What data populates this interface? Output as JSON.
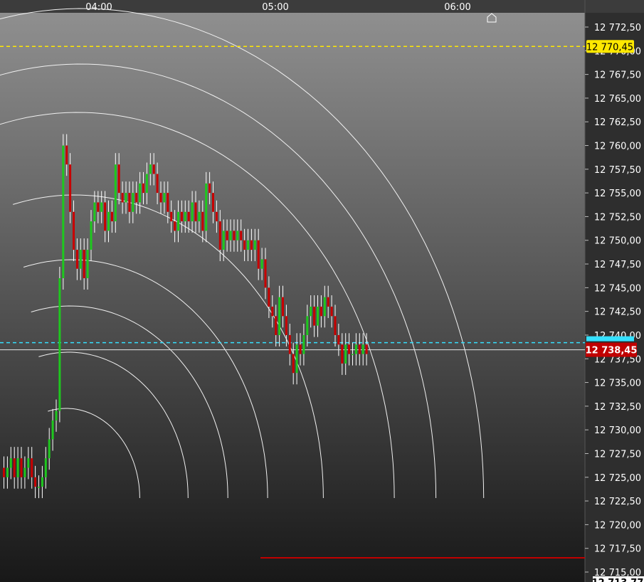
{
  "chart_data": {
    "type": "candlestick",
    "time_labels": [
      "04:00",
      "05:00",
      "06:00"
    ],
    "y_ticks": [
      "12 772,50",
      "12 770,00",
      "12 767,50",
      "12 765,00",
      "12 762,50",
      "12 760,00",
      "12 757,50",
      "12 755,00",
      "12 752,50",
      "12 750,00",
      "12 747,50",
      "12 745,00",
      "12 742,50",
      "12 740,00",
      "12 737,50",
      "12 735,00",
      "12 732,50",
      "12 730,00",
      "12 727,50",
      "12 725,00",
      "12 722,50",
      "12 720,00",
      "12 717,50",
      "12 715,00"
    ],
    "ylim": [
      12715.0,
      12772.5
    ],
    "current_price": {
      "label": "12 738,45",
      "value": 12738.45
    },
    "yellow_level": {
      "label": "12 770,45",
      "value": 12770.45
    },
    "cyan_level": {
      "value": 12739.2
    },
    "red_level": {
      "value": 12716.5
    },
    "bottom_tag": {
      "label": "12 713,77"
    },
    "candles_open_close": [
      [
        12726,
        12725
      ],
      [
        12725,
        12726
      ],
      [
        12726,
        12727
      ],
      [
        12727,
        12725
      ],
      [
        12725,
        12727
      ],
      [
        12727,
        12725
      ],
      [
        12725,
        12726
      ],
      [
        12726,
        12727
      ],
      [
        12727,
        12725
      ],
      [
        12725,
        12724
      ],
      [
        12724,
        12724
      ],
      [
        12724,
        12725
      ],
      [
        12725,
        12727
      ],
      [
        12727,
        12729
      ],
      [
        12729,
        12731
      ],
      [
        12731,
        12732
      ],
      [
        12732,
        12746
      ],
      [
        12746,
        12760
      ],
      [
        12760,
        12758
      ],
      [
        12758,
        12753
      ],
      [
        12753,
        12749
      ],
      [
        12749,
        12747
      ],
      [
        12747,
        12749
      ],
      [
        12749,
        12746
      ],
      [
        12746,
        12749
      ],
      [
        12749,
        12752
      ],
      [
        12752,
        12754
      ],
      [
        12754,
        12753
      ],
      [
        12753,
        12754
      ],
      [
        12754,
        12751
      ],
      [
        12751,
        12753
      ],
      [
        12753,
        12752
      ],
      [
        12752,
        12758
      ],
      [
        12758,
        12755
      ],
      [
        12755,
        12754
      ],
      [
        12754,
        12755
      ],
      [
        12755,
        12753
      ],
      [
        12753,
        12755
      ],
      [
        12755,
        12754
      ],
      [
        12754,
        12756
      ],
      [
        12756,
        12755
      ],
      [
        12755,
        12757
      ],
      [
        12757,
        12758
      ],
      [
        12758,
        12757
      ],
      [
        12757,
        12755
      ],
      [
        12755,
        12754
      ],
      [
        12754,
        12755
      ],
      [
        12755,
        12753
      ],
      [
        12753,
        12752
      ],
      [
        12752,
        12751
      ],
      [
        12751,
        12753
      ],
      [
        12753,
        12752
      ],
      [
        12752,
        12753
      ],
      [
        12753,
        12752
      ],
      [
        12752,
        12754
      ],
      [
        12754,
        12752
      ],
      [
        12752,
        12753
      ],
      [
        12753,
        12751
      ],
      [
        12751,
        12756
      ],
      [
        12756,
        12755
      ],
      [
        12755,
        12753
      ],
      [
        12753,
        12752
      ],
      [
        12752,
        12749
      ],
      [
        12749,
        12751
      ],
      [
        12751,
        12750
      ],
      [
        12750,
        12751
      ],
      [
        12751,
        12750
      ],
      [
        12750,
        12751
      ],
      [
        12751,
        12750
      ],
      [
        12750,
        12749
      ],
      [
        12749,
        12750
      ],
      [
        12750,
        12749
      ],
      [
        12749,
        12750
      ],
      [
        12750,
        12747
      ],
      [
        12747,
        12748
      ],
      [
        12748,
        12745
      ],
      [
        12745,
        12743
      ],
      [
        12743,
        12742
      ],
      [
        12742,
        12740
      ],
      [
        12740,
        12744
      ],
      [
        12744,
        12742
      ],
      [
        12742,
        12740
      ],
      [
        12740,
        12738
      ],
      [
        12738,
        12736
      ],
      [
        12736,
        12739
      ],
      [
        12739,
        12738
      ],
      [
        12738,
        12740
      ],
      [
        12740,
        12742
      ],
      [
        12742,
        12743
      ],
      [
        12743,
        12741
      ],
      [
        12741,
        12743
      ],
      [
        12743,
        12742
      ],
      [
        12742,
        12744
      ],
      [
        12744,
        12743
      ],
      [
        12743,
        12742
      ],
      [
        12742,
        12740
      ],
      [
        12740,
        12739
      ],
      [
        12739,
        12737
      ],
      [
        12737,
        12739
      ],
      [
        12739,
        12738
      ],
      [
        12738,
        12738
      ],
      [
        12738,
        12739
      ],
      [
        12739,
        12738
      ],
      [
        12738,
        12739
      ],
      [
        12739,
        12738
      ]
    ]
  }
}
